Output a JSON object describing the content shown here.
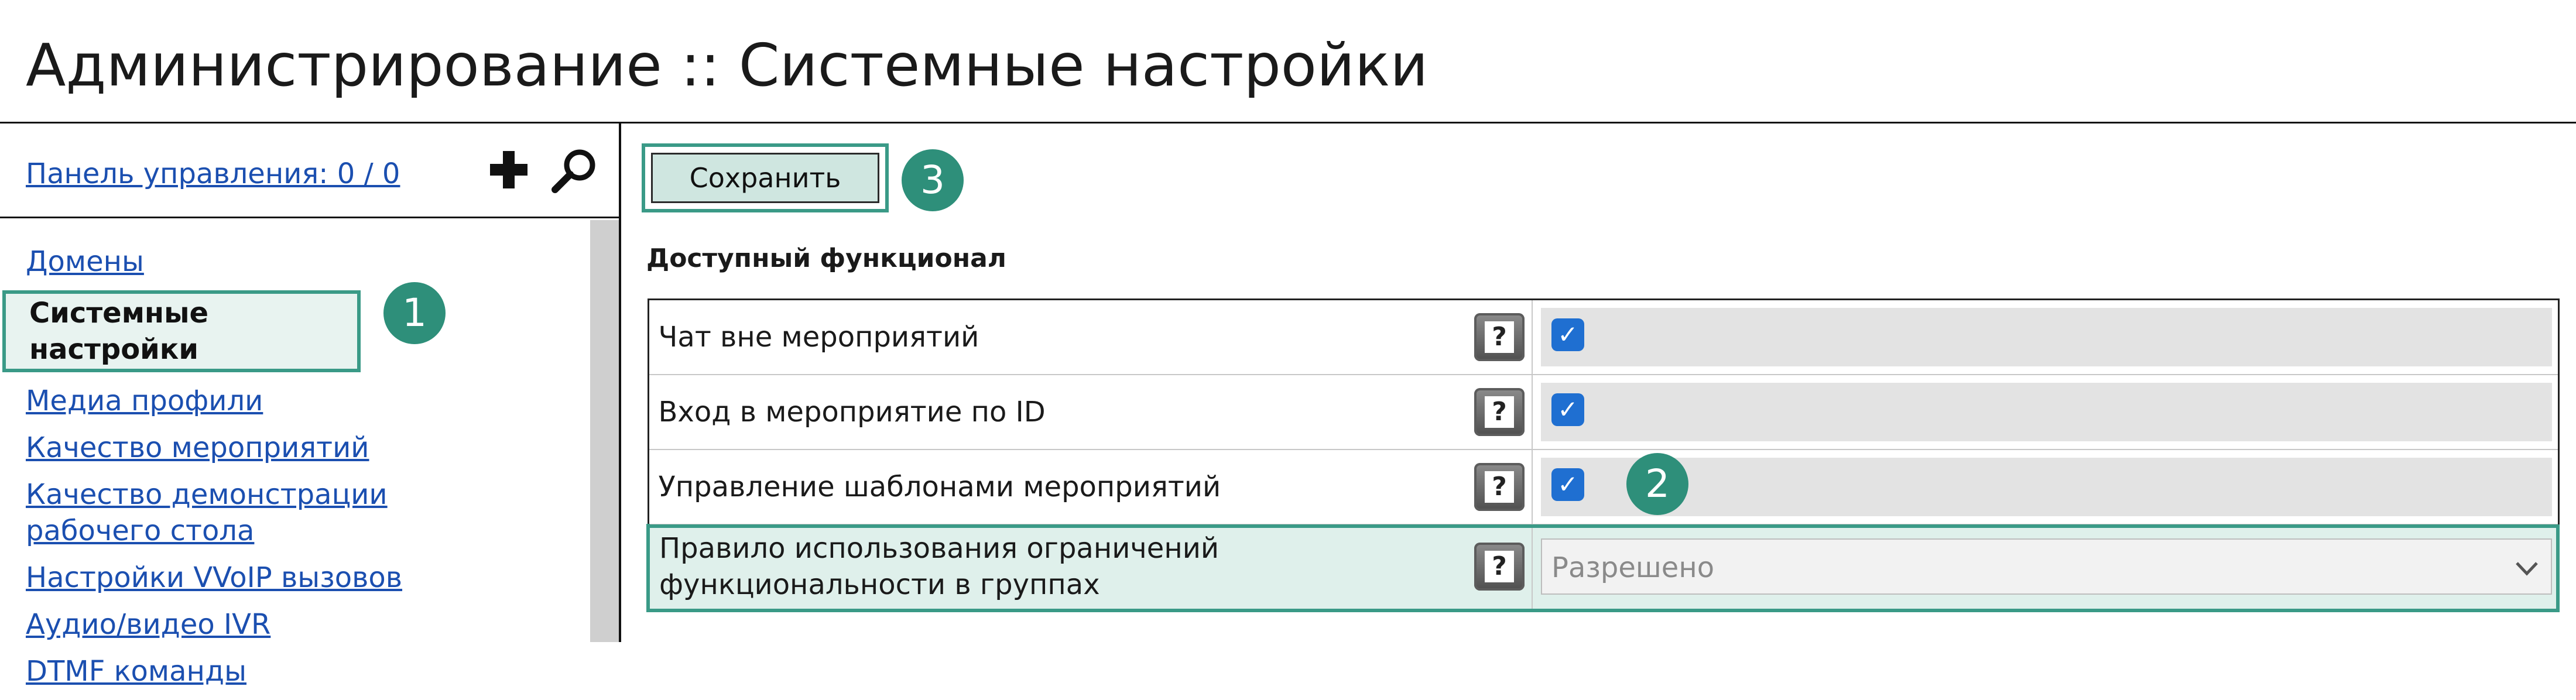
{
  "page": {
    "title": "Администрирование :: Системные настройки"
  },
  "sidebar": {
    "panel_link": "Панель управления: 0 / 0",
    "icons": [
      "plus-icon",
      "search-icon"
    ],
    "items": [
      {
        "label": "Домены",
        "active": false
      },
      {
        "label": "Системные настройки",
        "active": true
      },
      {
        "label": "Медиа профили",
        "active": false
      },
      {
        "label": "Качество мероприятий",
        "active": false
      },
      {
        "label": "Качество демонстрации рабочего стола",
        "active": false
      },
      {
        "label": "Настройки VVoIP вызовов",
        "active": false
      },
      {
        "label": "Аудио/видео IVR",
        "active": false
      },
      {
        "label": "DTMF команды",
        "active": false
      }
    ]
  },
  "toolbar": {
    "save_label": "Сохранить"
  },
  "badges": {
    "one": "1",
    "two": "2",
    "three": "3"
  },
  "section": {
    "title": "Доступный функционал"
  },
  "settings": [
    {
      "label": "Чат вне мероприятий",
      "type": "checkbox",
      "checked": true
    },
    {
      "label": "Вход в мероприятие по ID",
      "type": "checkbox",
      "checked": true
    },
    {
      "label": "Управление шаблонами мероприятий",
      "type": "checkbox",
      "checked": true
    },
    {
      "label_line1": "Правило использования ограничений",
      "label_line2": "функциональности в группах",
      "type": "select",
      "value": "Разрешено"
    }
  ],
  "colors": {
    "accent": "#2e8f7a",
    "highlight": "#dff0eb",
    "link": "#1b4fb0",
    "checkbox": "#1f6fd1"
  }
}
